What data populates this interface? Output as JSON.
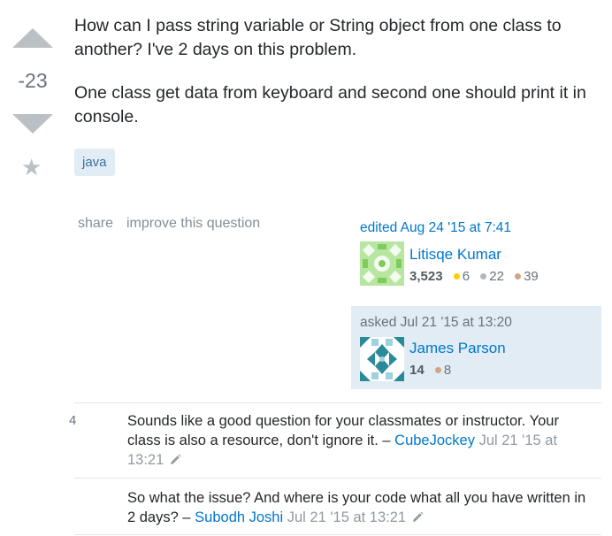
{
  "question": {
    "score": "-23",
    "paragraph1": "How can I pass string variable or String object from one class to another? I've 2 days on this problem.",
    "paragraph2": "One class get data from keyboard and second one should print it in console.",
    "tags": [
      "java"
    ],
    "menu": {
      "share": "share",
      "improve": "improve this question"
    }
  },
  "edited": {
    "label": "edited Aug 24 '15 at 7:41",
    "user": "Litisqe Kumar",
    "reputation": "3,523",
    "gold": "6",
    "silver": "22",
    "bronze": "39"
  },
  "asked": {
    "label": "asked Jul 21 '15 at 13:20",
    "user": "James Parson",
    "reputation": "14",
    "bronze": "8"
  },
  "comments": [
    {
      "score": "4",
      "text": "Sounds like a good question for your classmates or instructor. Your class is also a resource, don't ignore it. –",
      "user": "CubeJockey",
      "date": "Jul 21 '15 at 13:21"
    },
    {
      "score": "",
      "text": "So what the issue? And where is your code what all you have written in 2 days? –",
      "user": "Subodh Joshi",
      "date": "Jul 21 '15 at 13:21"
    }
  ],
  "colors": {
    "link": "#0077cc",
    "tag_bg": "#e1ecf4",
    "tag_text": "#39739d",
    "vote_arrow": "#bbc0c4",
    "gold": "#ffcc01",
    "silver": "#b4b8bc",
    "bronze": "#d1a684"
  },
  "icons": [
    "vote-up-icon",
    "vote-down-icon",
    "favorite-star-icon",
    "edit-pencil-icon"
  ]
}
